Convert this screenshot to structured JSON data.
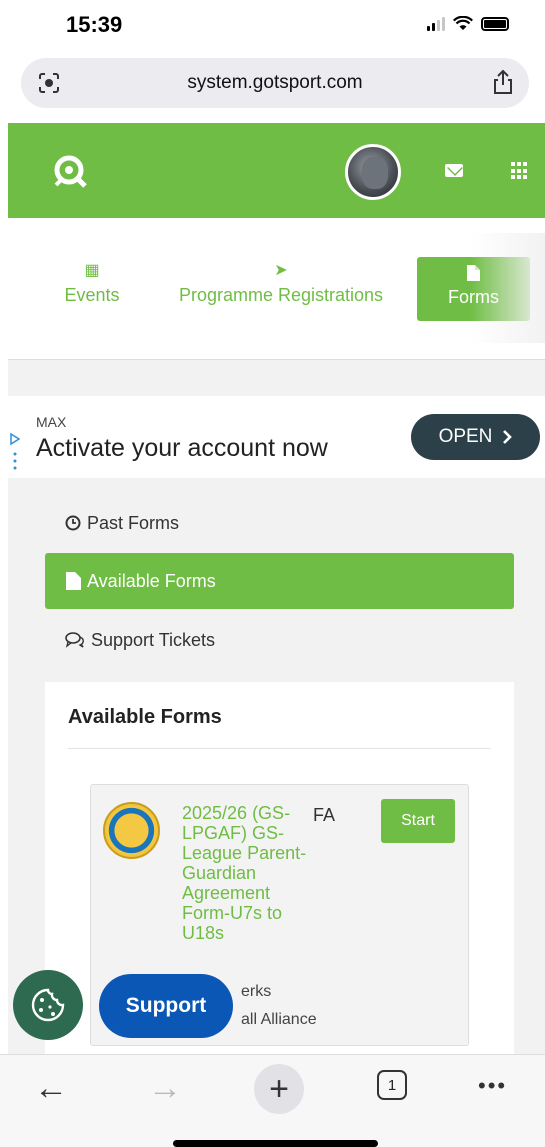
{
  "status_bar": {
    "time": "15:39"
  },
  "browser": {
    "url": "system.gotsport.com",
    "tab_count": "1"
  },
  "nav_tabs": [
    {
      "label": "Events",
      "icon": "calendar-icon"
    },
    {
      "label": "Programme Registrations",
      "icon": "paper-plane-icon"
    },
    {
      "label": "Forms",
      "icon": "file-icon"
    }
  ],
  "ad": {
    "sponsor": "MAX",
    "headline": "Activate your account now",
    "button": "OPEN"
  },
  "side_menu": {
    "past": "Past Forms",
    "available": "Available Forms",
    "support": "Support Tickets"
  },
  "card": {
    "title": "Available Forms",
    "form": {
      "name": "2025/26 (GS-LPGAF) GS-League Parent-Guardian Agreement Form-U7s to U18s",
      "org": "FA",
      "start_label": "Start",
      "meta1": "erks",
      "meta2": "all Alliance"
    }
  },
  "support_label": "Support",
  "colors": {
    "brand_green": "#6fbd44",
    "support_blue": "#0a57b5",
    "ad_button": "#2b4049"
  }
}
